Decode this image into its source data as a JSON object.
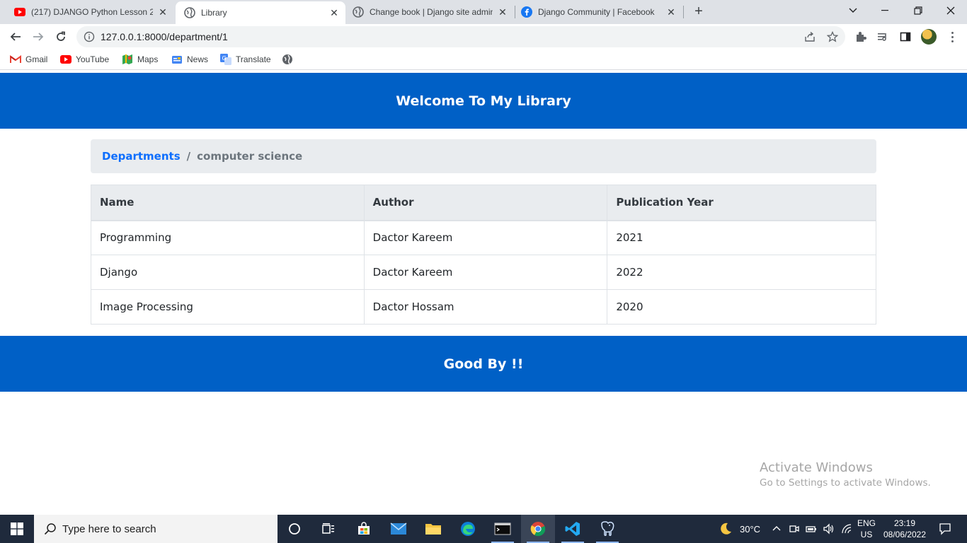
{
  "browser": {
    "tabs": [
      {
        "title": "(217) DJANGO Python Lesson 25",
        "icon": "youtube-icon",
        "active": false
      },
      {
        "title": "Library",
        "icon": "globe-icon",
        "active": true
      },
      {
        "title": "Change book | Django site admin",
        "icon": "globe-icon",
        "active": false
      },
      {
        "title": "Django Community | Facebook",
        "icon": "facebook-icon",
        "active": false
      }
    ],
    "new_tab_symbol": "+",
    "url": "127.0.0.1:8000/department/1",
    "bookmarks": [
      {
        "label": "Gmail",
        "icon": "gmail-icon"
      },
      {
        "label": "YouTube",
        "icon": "youtube-icon"
      },
      {
        "label": "Maps",
        "icon": "maps-icon"
      },
      {
        "label": "News",
        "icon": "news-icon"
      },
      {
        "label": "Translate",
        "icon": "translate-icon"
      }
    ]
  },
  "site": {
    "header_title": "Welcome To My Library",
    "breadcrumb": {
      "link_label": "Departments",
      "separator": "/",
      "current": "computer science"
    },
    "table": {
      "headers": [
        "Name",
        "Author",
        "Publication Year"
      ],
      "rows": [
        [
          "Programming",
          "Dactor Kareem",
          "2021"
        ],
        [
          "Django",
          "Dactor Kareem",
          "2022"
        ],
        [
          "Image Processing",
          "Dactor Hossam",
          "2020"
        ]
      ]
    },
    "footer_text": "Good By !!"
  },
  "watermark": {
    "line1": "Activate Windows",
    "line2": "Go to Settings to activate Windows."
  },
  "taskbar": {
    "search_placeholder": "Type here to search",
    "weather": "30°C",
    "language": "ENG",
    "region": "US",
    "time": "23:19",
    "date": "08/06/2022"
  },
  "colors": {
    "brand_blue": "#0060c6",
    "link_blue": "#0d6efd",
    "breadcrumb_bg": "#e9ecef",
    "taskbar_bg": "#1f2a3c"
  }
}
